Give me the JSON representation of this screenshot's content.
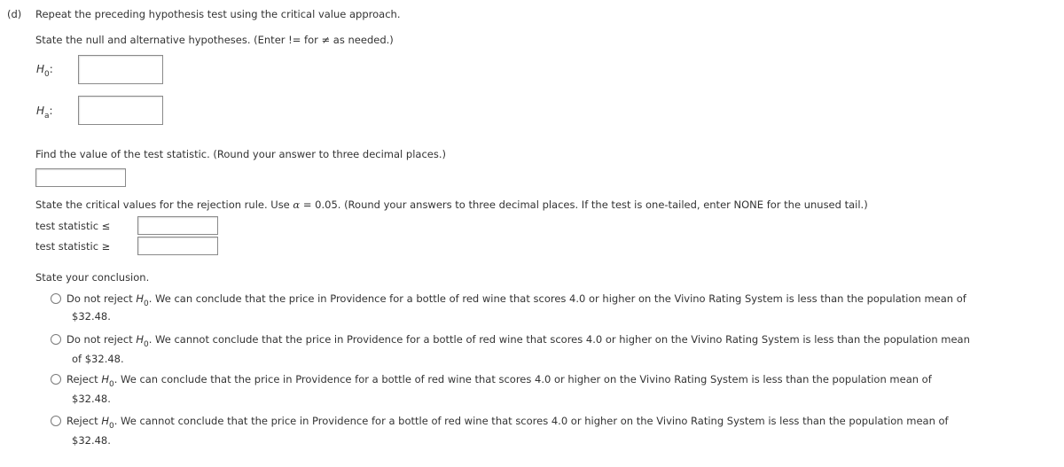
{
  "part_label": "(d)",
  "part_instruction": "Repeat the preceding hypothesis test using the critical value approach.",
  "hypotheses": {
    "instruction": "State the null and alternative hypotheses. (Enter != for ≠ as needed.)",
    "null_label_main": "H",
    "null_label_sub": "0",
    "alt_label_main": "H",
    "alt_label_sub": "a",
    "colon": ":",
    "null_value": "",
    "alt_value": ""
  },
  "test_statistic": {
    "instruction": "Find the value of the test statistic. (Round your answer to three decimal places.)",
    "value": ""
  },
  "critical_values": {
    "instruction_before_alpha": "State the critical values for the rejection rule. Use ",
    "alpha_symbol": "α",
    "instruction_after_alpha": " = 0.05. (Round your answers to three decimal places. If the test is one-tailed, enter NONE for the unused tail.)",
    "lower_label": "test statistic ≤",
    "upper_label": "test statistic ≥",
    "lower_value": "",
    "upper_value": ""
  },
  "conclusion": {
    "instruction": "State your conclusion.",
    "options": [
      {
        "prefix": "Do not reject ",
        "h": "H",
        "sub": "0",
        "line1": ". We can conclude that the price in Providence for a bottle of red wine that scores 4.0 or higher on the Vivino Rating System is less than the population mean of",
        "line2": "$32.48.",
        "selected": false
      },
      {
        "prefix": "Do not reject ",
        "h": "H",
        "sub": "0",
        "line1": ". We cannot conclude that the price in Providence for a bottle of red wine that scores 4.0 or higher on the Vivino Rating System is less than the population mean",
        "line2": "of $32.48.",
        "selected": false
      },
      {
        "prefix": "Reject ",
        "h": "H",
        "sub": "0",
        "line1": ". We can conclude that the price in Providence for a bottle of red wine that scores 4.0 or higher on the Vivino Rating System is less than the population mean of",
        "line2": "$32.48.",
        "selected": false
      },
      {
        "prefix": "Reject ",
        "h": "H",
        "sub": "0",
        "line1": ". We cannot conclude that the price in Providence for a bottle of red wine that scores 4.0 or higher on the Vivino Rating System is less than the population mean of",
        "line2": "$32.48.",
        "selected": false
      }
    ]
  }
}
